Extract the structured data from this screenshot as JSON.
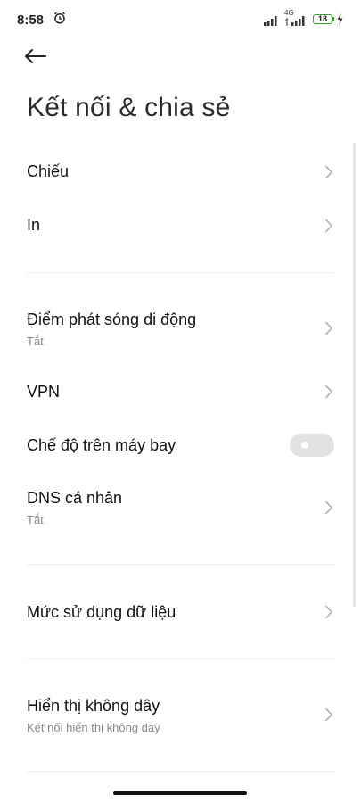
{
  "status_bar": {
    "time": "8:58",
    "network_type": "4G",
    "battery_level": "18",
    "icons": [
      "alarm-icon",
      "signal-icon",
      "signal-icon",
      "battery-icon",
      "charging-icon"
    ]
  },
  "header": {
    "back_icon": "arrow-left-icon",
    "title": "Kết nối & chia sẻ"
  },
  "items": {
    "cast": {
      "label": "Chiếu"
    },
    "print": {
      "label": "In"
    },
    "hotspot": {
      "label": "Điểm phát sóng di động",
      "status": "Tắt"
    },
    "vpn": {
      "label": "VPN"
    },
    "airplane": {
      "label": "Chế độ trên máy bay",
      "enabled": false
    },
    "private_dns": {
      "label": "DNS cá nhân",
      "status": "Tắt"
    },
    "data_usage": {
      "label": "Mức sử dụng dữ liệu"
    },
    "wireless_display": {
      "label": "Hiển thị không dây",
      "subtitle": "Kết nối hiển thị không dây"
    }
  },
  "colors": {
    "background": "#ffffff",
    "toggle_off": "#e2e2e2",
    "secondary_text": "#888888",
    "battery": "#3a9d3a"
  }
}
